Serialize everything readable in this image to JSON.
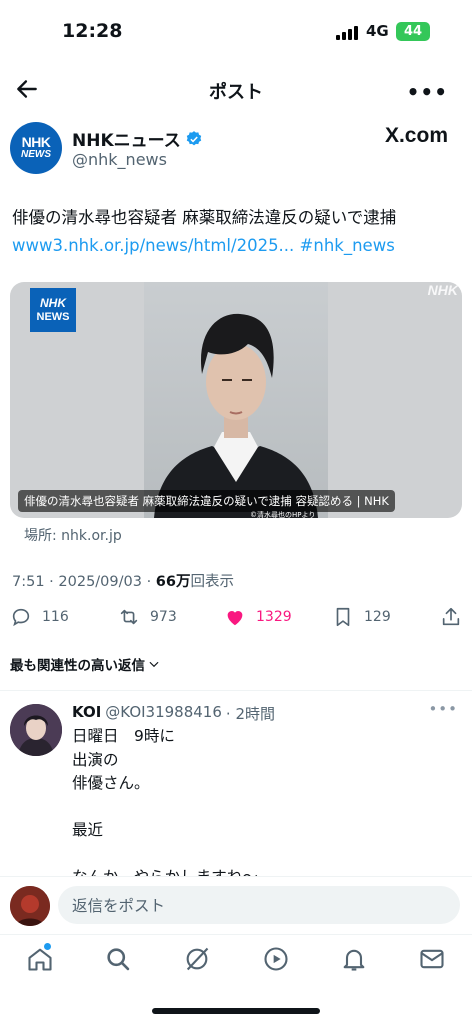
{
  "status_bar": {
    "time": "12:28",
    "network": "4G",
    "battery": "44"
  },
  "header": {
    "title": "ポスト"
  },
  "author": {
    "name": "NHKニュース",
    "handle": "@nhk_news",
    "avatar_line1": "NHK",
    "avatar_line2": "NEWS",
    "badge": "X.com"
  },
  "tweet": {
    "text": "俳優の清水尋也容疑者 麻薬取締法違反の疑いで逮捕",
    "link": "www3.nhk.or.jp/news/html/2025...",
    "hashtag": "#nhk_news"
  },
  "card": {
    "logo_line1": "NHK",
    "logo_line2": "NEWS",
    "watermark": "NHK",
    "caption": "俳優の清水尋也容疑者 麻薬取締法違反の疑いで逮捕 容疑認める | NHK",
    "credit": "©清水尋也のHPより",
    "source": "場所: nhk.or.jp"
  },
  "meta": {
    "timestamp": "7:51 · 2025/09/03 · ",
    "views": "66万",
    "views_suffix": "回表示"
  },
  "actions": {
    "replies": "116",
    "reposts": "973",
    "likes": "1329",
    "bookmarks": "129"
  },
  "colors": {
    "accent": "#1d9bf0",
    "like": "#f91880",
    "nhk_blue": "#0a62b8"
  },
  "relevance": {
    "label": "最も関連性の高い返信"
  },
  "reply": {
    "name": "KOI",
    "handle": "@KOI31988416",
    "time": "· 2時間",
    "text": "日曜日　9時に\n出演の\n俳優さん。\n\n最近\n\nなんか、やらかしますね〜"
  },
  "composer": {
    "placeholder": "返信をポスト"
  },
  "tabs": [
    "home-icon",
    "search-icon",
    "grok-icon",
    "video-icon",
    "notifications-icon",
    "messages-icon"
  ]
}
